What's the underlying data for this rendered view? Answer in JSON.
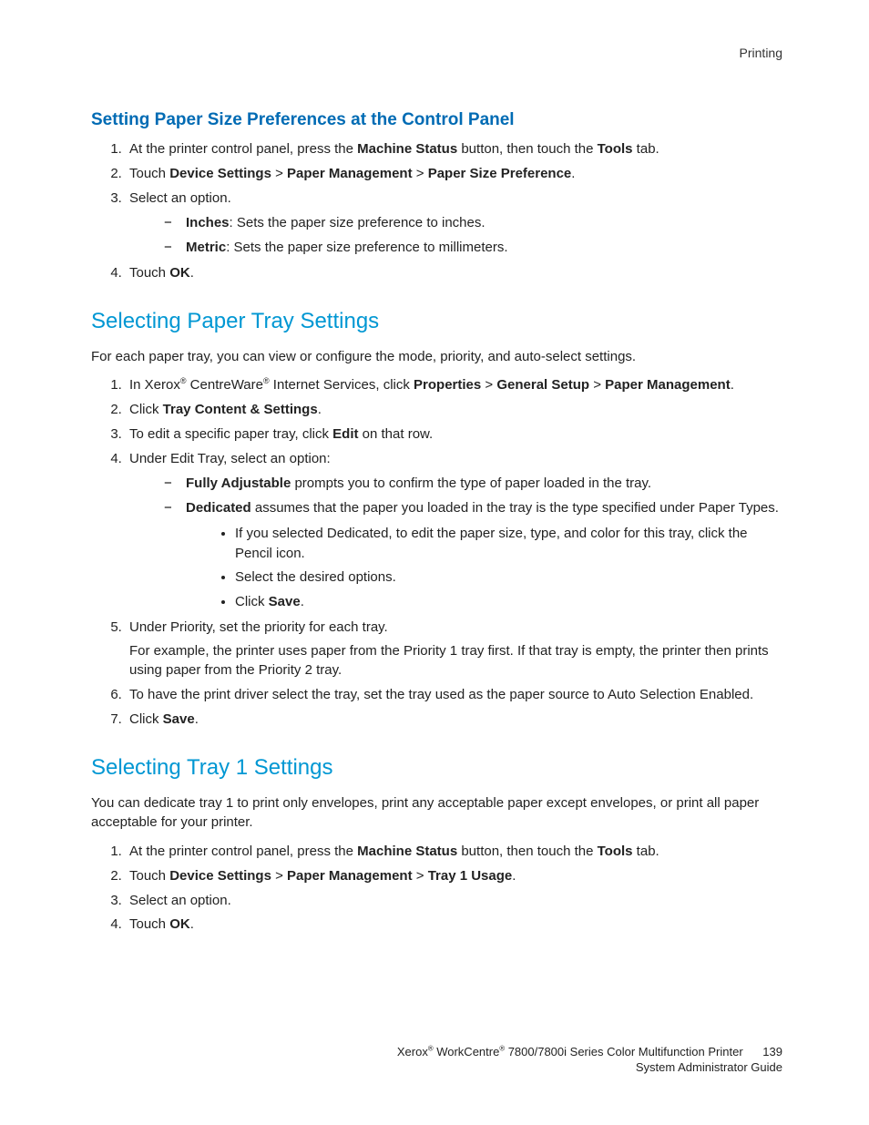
{
  "header": {
    "section_label": "Printing"
  },
  "section1": {
    "heading": "Setting Paper Size Preferences at the Control Panel",
    "steps": [
      {
        "parts": [
          {
            "t": "At the printer control panel, press the "
          },
          {
            "t": "Machine Status",
            "b": true
          },
          {
            "t": " button, then touch the "
          },
          {
            "t": "Tools",
            "b": true
          },
          {
            "t": " tab."
          }
        ]
      },
      {
        "parts": [
          {
            "t": "Touch "
          },
          {
            "t": "Device Settings",
            "b": true
          },
          {
            "t": " > "
          },
          {
            "t": "Paper Management",
            "b": true
          },
          {
            "t": " > "
          },
          {
            "t": "Paper Size Preference",
            "b": true
          },
          {
            "t": "."
          }
        ]
      },
      {
        "parts": [
          {
            "t": "Select an option."
          }
        ],
        "sub_dash": [
          {
            "parts": [
              {
                "t": "Inches",
                "b": true
              },
              {
                "t": ": Sets the paper size preference to inches."
              }
            ]
          },
          {
            "parts": [
              {
                "t": "Metric",
                "b": true
              },
              {
                "t": ": Sets the paper size preference to millimeters."
              }
            ]
          }
        ]
      },
      {
        "parts": [
          {
            "t": "Touch "
          },
          {
            "t": "OK",
            "b": true
          },
          {
            "t": "."
          }
        ]
      }
    ]
  },
  "section2": {
    "heading": "Selecting Paper Tray Settings",
    "intro": "For each paper tray, you can view or configure the mode, priority, and auto-select settings.",
    "steps": [
      {
        "parts": [
          {
            "t": "In Xerox"
          },
          {
            "t": "®",
            "sup": true
          },
          {
            "t": " CentreWare"
          },
          {
            "t": "®",
            "sup": true
          },
          {
            "t": " Internet Services, click "
          },
          {
            "t": "Properties",
            "b": true
          },
          {
            "t": " > "
          },
          {
            "t": "General Setup",
            "b": true
          },
          {
            "t": " > "
          },
          {
            "t": "Paper Management",
            "b": true
          },
          {
            "t": "."
          }
        ]
      },
      {
        "parts": [
          {
            "t": "Click "
          },
          {
            "t": "Tray Content & Settings",
            "b": true
          },
          {
            "t": "."
          }
        ]
      },
      {
        "parts": [
          {
            "t": "To edit a specific paper tray, click "
          },
          {
            "t": "Edit",
            "b": true
          },
          {
            "t": " on that row."
          }
        ]
      },
      {
        "parts": [
          {
            "t": "Under Edit Tray, select an option:"
          }
        ],
        "sub_dash": [
          {
            "parts": [
              {
                "t": "Fully Adjustable",
                "b": true
              },
              {
                "t": " prompts you to confirm the type of paper loaded in the tray."
              }
            ]
          },
          {
            "parts": [
              {
                "t": "Dedicated",
                "b": true
              },
              {
                "t": " assumes that the paper you loaded in the tray is the type specified under Paper Types."
              }
            ],
            "sub_disc": [
              {
                "parts": [
                  {
                    "t": "If you selected Dedicated, to edit the paper size, type, and color for this tray, click the Pencil icon."
                  }
                ]
              },
              {
                "parts": [
                  {
                    "t": "Select the desired options."
                  }
                ]
              },
              {
                "parts": [
                  {
                    "t": "Click "
                  },
                  {
                    "t": "Save",
                    "b": true
                  },
                  {
                    "t": "."
                  }
                ]
              }
            ]
          }
        ]
      },
      {
        "parts": [
          {
            "t": "Under Priority, set the priority for each tray."
          }
        ],
        "extra_paras": [
          {
            "parts": [
              {
                "t": "For example, the printer uses paper from the Priority 1 tray first. If that tray is empty, the printer then prints using paper from the Priority 2 tray."
              }
            ]
          }
        ]
      },
      {
        "parts": [
          {
            "t": "To have the print driver select the tray, set the tray used as the paper source to Auto Selection Enabled."
          }
        ]
      },
      {
        "parts": [
          {
            "t": "Click "
          },
          {
            "t": "Save",
            "b": true
          },
          {
            "t": "."
          }
        ]
      }
    ]
  },
  "section3": {
    "heading": "Selecting Tray 1 Settings",
    "intro": "You can dedicate tray 1 to print only envelopes, print any acceptable paper except envelopes, or print all paper acceptable for your printer.",
    "steps": [
      {
        "parts": [
          {
            "t": "At the printer control panel, press the "
          },
          {
            "t": "Machine Status",
            "b": true
          },
          {
            "t": " button, then touch the "
          },
          {
            "t": "Tools",
            "b": true
          },
          {
            "t": " tab."
          }
        ]
      },
      {
        "parts": [
          {
            "t": "Touch "
          },
          {
            "t": "Device Settings",
            "b": true
          },
          {
            "t": " > "
          },
          {
            "t": "Paper Management",
            "b": true
          },
          {
            "t": " > "
          },
          {
            "t": "Tray 1 Usage",
            "b": true
          },
          {
            "t": "."
          }
        ]
      },
      {
        "parts": [
          {
            "t": "Select an option."
          }
        ]
      },
      {
        "parts": [
          {
            "t": "Touch "
          },
          {
            "t": "OK",
            "b": true
          },
          {
            "t": "."
          }
        ]
      }
    ]
  },
  "footer": {
    "line1_pre": "Xerox",
    "line1_mid": " WorkCentre",
    "line1_post": " 7800/7800i Series Color Multifunction Printer",
    "line2": "System Administrator Guide",
    "page_number": "139"
  }
}
